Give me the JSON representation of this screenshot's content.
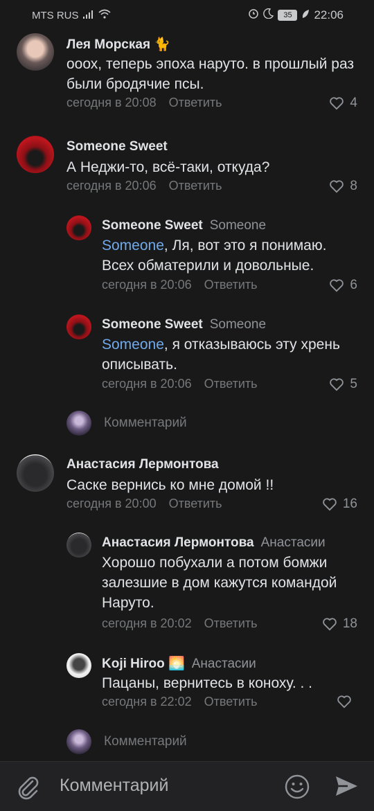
{
  "status": {
    "carrier": "MTS RUS",
    "battery": "35",
    "time": "22:06"
  },
  "comments": [
    {
      "name": "Лея Морская 🐈",
      "reply_to": "",
      "mention": "",
      "text": "ооох, теперь эпоха наруто. в прошлый раз были бродячие псы.",
      "time": "сегодня в 20:08",
      "reply_label": "Ответить",
      "likes": "4"
    },
    {
      "name": "Someone Sweet",
      "reply_to": "",
      "mention": "",
      "text": "А Неджи-то, всё-таки, откуда?",
      "time": "сегодня в 20:06",
      "reply_label": "Ответить",
      "likes": "8"
    },
    {
      "name": "Someone Sweet",
      "reply_to": "Someone",
      "mention": "Someone",
      "text": ", Ля, вот это я понимаю. Всех обматерили и довольные.",
      "time": "сегодня в 20:06",
      "reply_label": "Ответить",
      "likes": "6"
    },
    {
      "name": "Someone Sweet",
      "reply_to": "Someone",
      "mention": "Someone",
      "text": ", я отказываюсь эту хрень описывать.",
      "time": "сегодня в 20:06",
      "reply_label": "Ответить",
      "likes": "5"
    },
    {
      "name": "Анастасия Лермонтова",
      "reply_to": "",
      "mention": "",
      "text": "Саске вернись ко мне домой !!",
      "time": "сегодня в 20:00",
      "reply_label": "Ответить",
      "likes": "16"
    },
    {
      "name": "Анастасия Лермонтова",
      "reply_to": "Анастасии",
      "mention": "",
      "text": "Хорошо побухали а потом бомжи залезшие в дом кажутся командой Наруто.",
      "time": "сегодня в 20:02",
      "reply_label": "Ответить",
      "likes": "18"
    },
    {
      "name": "Koji Hiroo 🌅",
      "reply_to": "Анастасии",
      "mention": "",
      "text": "Пацаны, вернитесь в коноху. . .",
      "time": "сегодня в 22:02",
      "reply_label": "Ответить",
      "likes": ""
    }
  ],
  "comment_prompt": "Комментарий",
  "composer": {
    "placeholder": "Комментарий"
  },
  "colors": {
    "background": "#19191a",
    "mention": "#71aaeb",
    "muted": "#76787a"
  }
}
